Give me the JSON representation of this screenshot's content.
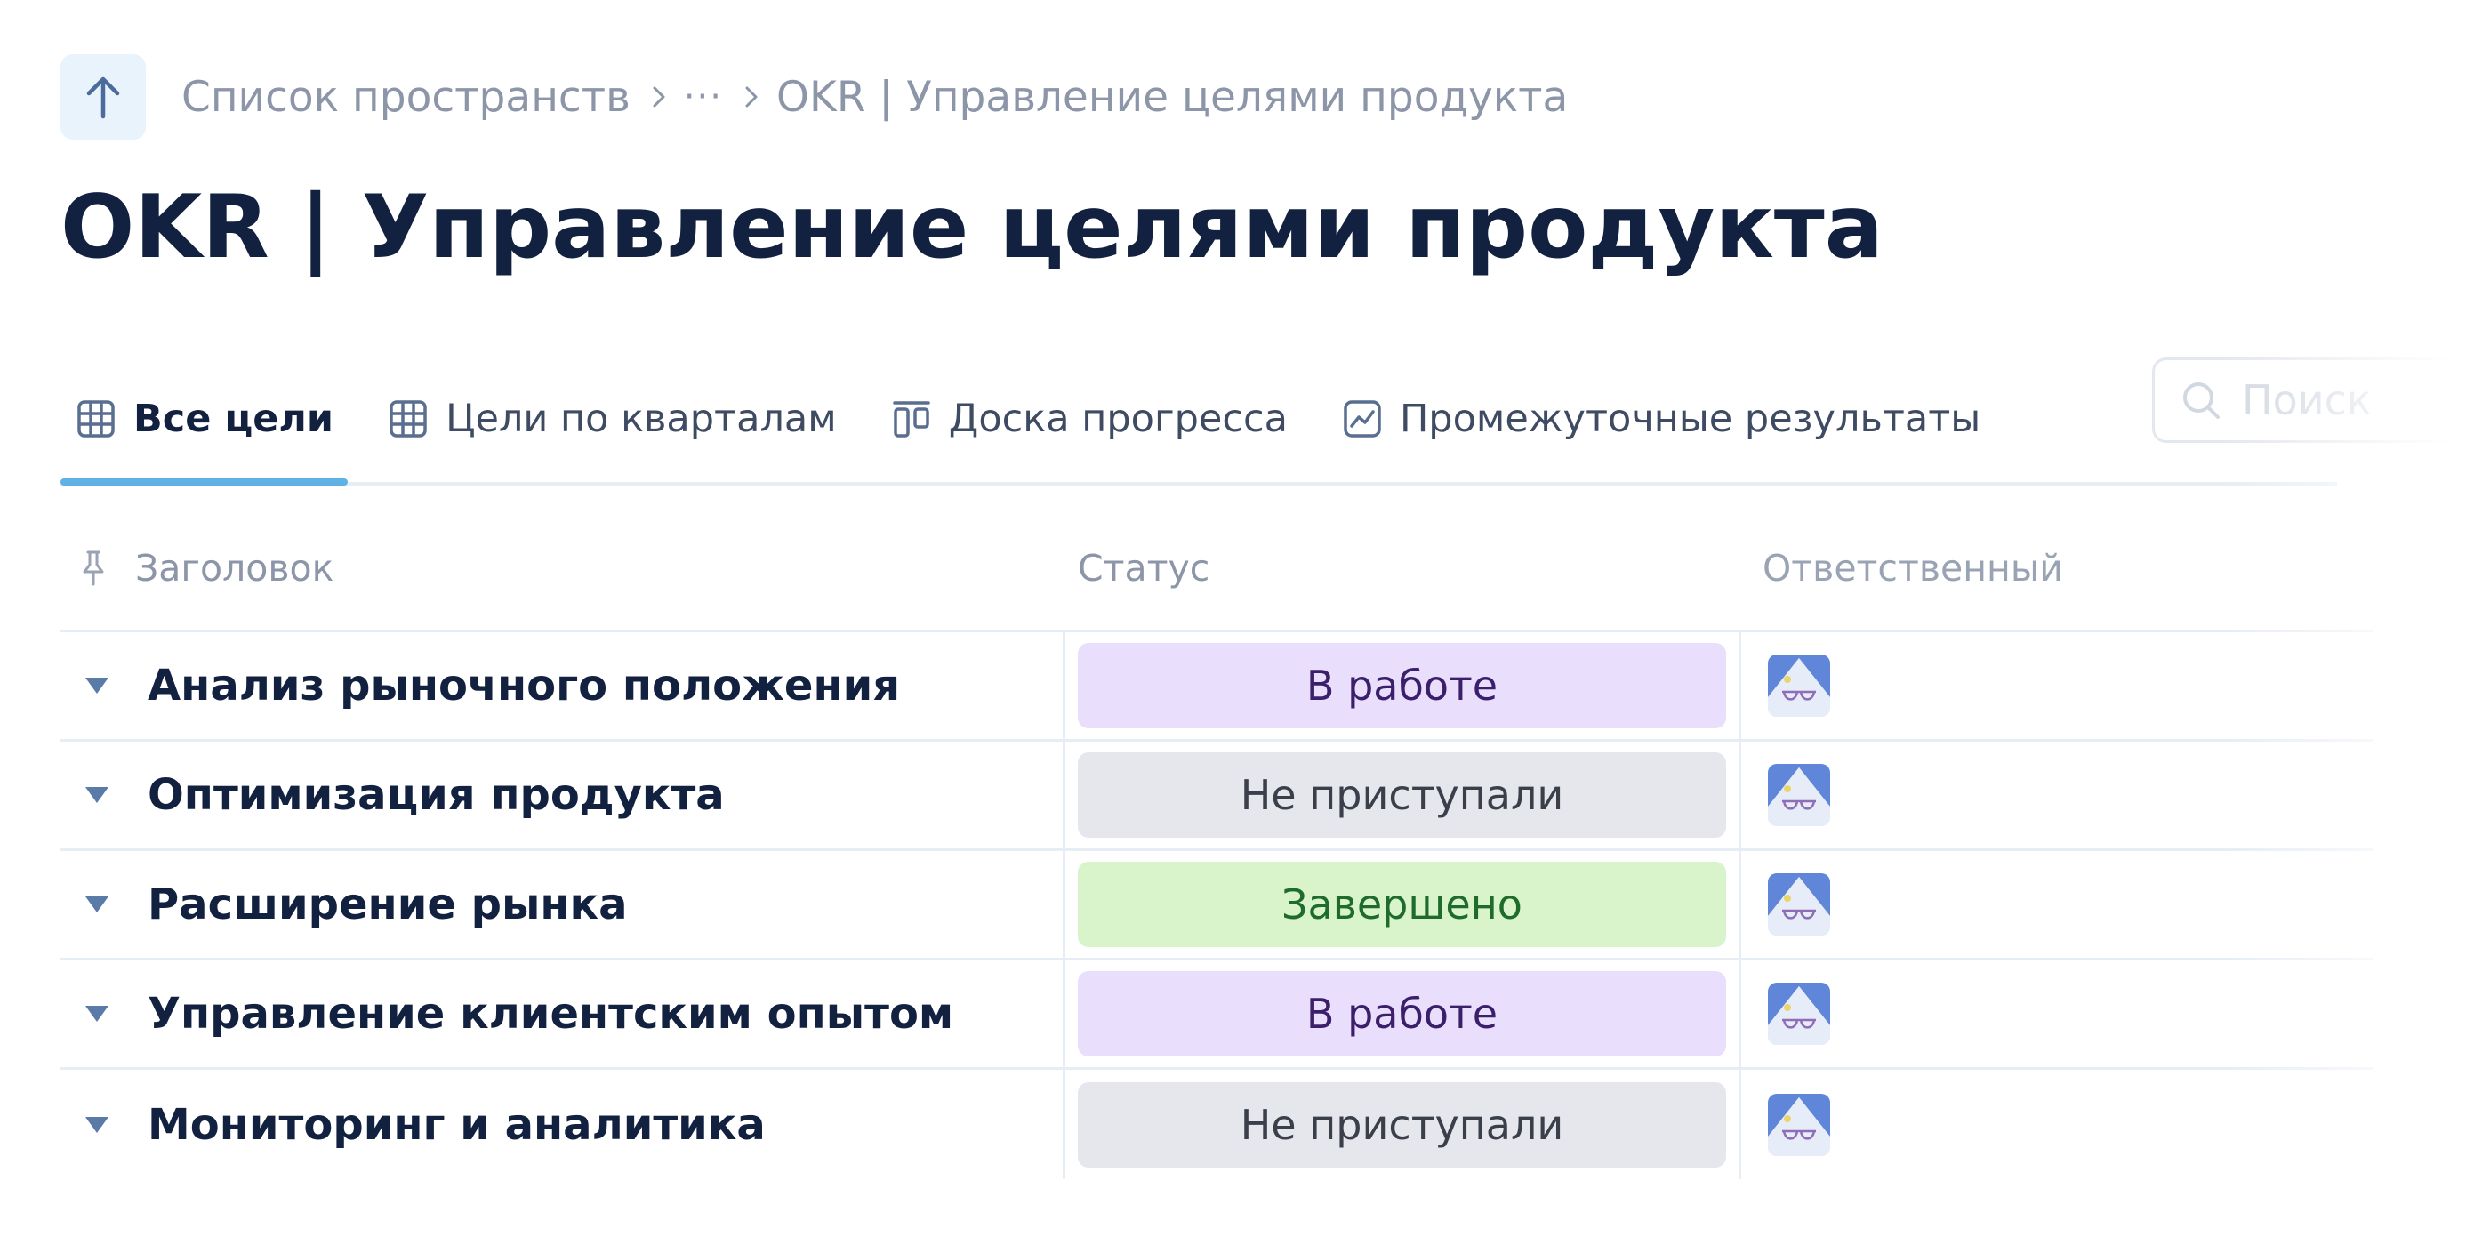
{
  "breadcrumb": {
    "items": [
      "Список пространств",
      "OKR | Управление целями продукта"
    ],
    "ellipsis": "···"
  },
  "page": {
    "title": "OKR | Управление целями продукта"
  },
  "tabs": [
    {
      "label": "Все цели",
      "icon": "table-icon",
      "active": true
    },
    {
      "label": "Цели по кварталам",
      "icon": "table-icon",
      "active": false
    },
    {
      "label": "Доска прогресса",
      "icon": "board-icon",
      "active": false
    },
    {
      "label": "Промежуточные результаты",
      "icon": "chart-icon",
      "active": false
    }
  ],
  "search": {
    "placeholder": "Поиск"
  },
  "table": {
    "columns": {
      "title": "Заголовок",
      "status": "Статус",
      "owner": "Ответственный"
    },
    "rows": [
      {
        "title": "Анализ рыночного положения",
        "status": "В работе"
      },
      {
        "title": "Оптимизация продукта",
        "status": "Не приступали"
      },
      {
        "title": "Расширение рынка",
        "status": "Завершено"
      },
      {
        "title": "Управление клиентским опытом",
        "status": "В работе"
      },
      {
        "title": "Мониторинг и аналитика",
        "status": "Не приступали"
      }
    ]
  },
  "colors": {
    "accent": "#60b1e4",
    "status_in_work": "#e9dffd",
    "status_not_started": "#e5e7ec",
    "status_done": "#d9f4cb"
  }
}
